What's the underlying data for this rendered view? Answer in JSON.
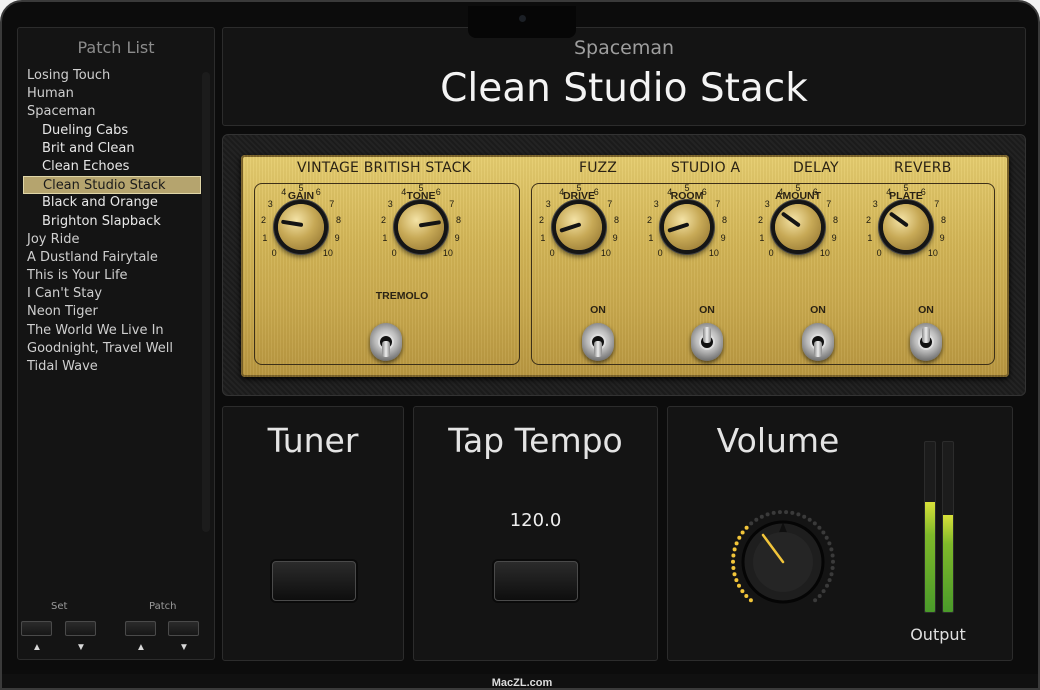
{
  "sidebar": {
    "title": "Patch List",
    "items": [
      {
        "label": "Losing Touch",
        "level": 0
      },
      {
        "label": "Human",
        "level": 0
      },
      {
        "label": "Spaceman",
        "level": 0
      },
      {
        "label": "Dueling Cabs",
        "level": 1
      },
      {
        "label": "Brit and Clean",
        "level": 1
      },
      {
        "label": "Clean Echoes",
        "level": 1
      },
      {
        "label": "Clean Studio Stack",
        "level": 1,
        "selected": true
      },
      {
        "label": "Black and Orange",
        "level": 1
      },
      {
        "label": "Brighton Slapback",
        "level": 1
      },
      {
        "label": "Joy Ride",
        "level": 0
      },
      {
        "label": "A Dustland Fairytale",
        "level": 0
      },
      {
        "label": "This is Your Life",
        "level": 0
      },
      {
        "label": "I Can't Stay",
        "level": 0
      },
      {
        "label": "Neon Tiger",
        "level": 0
      },
      {
        "label": "The World We Live In",
        "level": 0
      },
      {
        "label": "Goodnight, Travel Well",
        "level": 0
      },
      {
        "label": "Tidal Wave",
        "level": 0
      }
    ],
    "set_label": "Set",
    "patch_label": "Patch",
    "up_arrow": "▲",
    "down_arrow": "▼"
  },
  "header": {
    "bank": "Spaceman",
    "preset": "Clean Studio Stack"
  },
  "amp": {
    "sections": {
      "amp": "VINTAGE BRITISH STACK",
      "fuzz": "FUZZ",
      "room": "STUDIO A",
      "delay": "DELAY",
      "reverb": "REVERB"
    },
    "knobs": [
      {
        "label": "GAIN",
        "value": 2
      },
      {
        "label": "TONE",
        "value": 8
      },
      {
        "label": "DRIVE",
        "value": 1
      },
      {
        "label": "ROOM",
        "value": 1
      },
      {
        "label": "AMOUNT",
        "value": 3
      },
      {
        "label": "PLATE",
        "value": 3
      }
    ],
    "tick_labels": [
      "0",
      "1",
      "2",
      "3",
      "4",
      "5",
      "6",
      "7",
      "8",
      "9",
      "10"
    ],
    "tremolo_label": "TREMOLO",
    "on_label": "ON"
  },
  "tuner": {
    "title": "Tuner"
  },
  "tap_tempo": {
    "title": "Tap Tempo",
    "bpm": "120.0"
  },
  "volume": {
    "title": "Volume",
    "output_label": "Output",
    "meter_left": 0.65,
    "meter_right": 0.57
  },
  "footer": {
    "watermark": "MacZL.com"
  },
  "colors": {
    "selection": "#b5a46e",
    "amp_face": "#d3b556",
    "volume_ring": "#f2c53a",
    "meter_green": "#7fb92a"
  }
}
